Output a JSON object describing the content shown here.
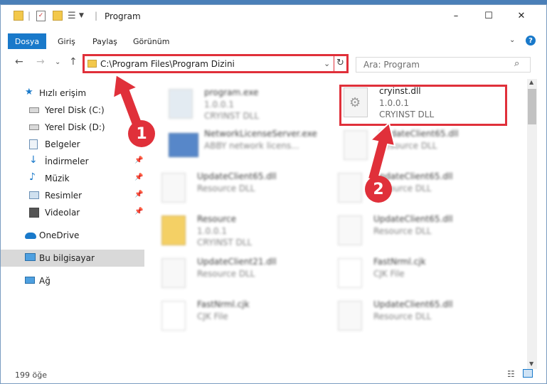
{
  "titlebar": {
    "title": "Program",
    "minimize": "–",
    "maximize": "☐",
    "close": "✕"
  },
  "ribbon": {
    "file_tab": "Dosya",
    "tabs": [
      "Giriş",
      "Paylaş",
      "Görünüm"
    ],
    "help": "?"
  },
  "nav": {
    "address": "C:\\Program Files\\Program Dizini",
    "search_placeholder": "Ara: Program"
  },
  "sidebar": {
    "items": [
      {
        "label": "Hızlı erişim",
        "icon": "star-icon"
      },
      {
        "label": "Yerel Disk (C:)",
        "icon": "drive-icon"
      },
      {
        "label": "Yerel Disk (D:)",
        "icon": "drive-icon"
      },
      {
        "label": "Belgeler",
        "icon": "documents-icon"
      },
      {
        "label": "İndirmeler",
        "icon": "download-icon"
      },
      {
        "label": "Müzik",
        "icon": "music-icon"
      },
      {
        "label": "Resimler",
        "icon": "pictures-icon"
      },
      {
        "label": "Videolar",
        "icon": "video-icon"
      },
      {
        "label": "OneDrive",
        "icon": "cloud-icon"
      },
      {
        "label": "Bu bilgisayar",
        "icon": "computer-icon"
      },
      {
        "label": "Ağ",
        "icon": "network-icon"
      }
    ]
  },
  "files": [
    {
      "name": "program.exe",
      "l2": "1.0.0.1",
      "l3": "CRYINST DLL"
    },
    {
      "name": "cryinst.dll",
      "l2": "1.0.0.1",
      "l3": "CRYINST DLL"
    },
    {
      "name": "NetworkLicenseServer.exe",
      "l2": "ABBY network licens...",
      "l3": ""
    },
    {
      "name": "UpdateClient65.dll",
      "l2": "Resource DLL",
      "l3": ""
    },
    {
      "name": "UpdateClient65.dll",
      "l2": "Resource DLL",
      "l3": ""
    },
    {
      "name": "UpdateClient65.dll",
      "l2": "Resource DLL",
      "l3": ""
    },
    {
      "name": "Resource",
      "l2": "1.0.0.1",
      "l3": "CRYINST DLL"
    },
    {
      "name": "UpdateClient65.dll",
      "l2": "Resource DLL",
      "l3": ""
    },
    {
      "name": "UpdateClient21.dll",
      "l2": "Resource DLL",
      "l3": ""
    },
    {
      "name": "FastNrml.cjk",
      "l2": "CJK File",
      "l3": ""
    },
    {
      "name": "FastNrml.cjk",
      "l2": "CJK File",
      "l3": ""
    },
    {
      "name": "UpdateClient65.dll",
      "l2": "Resource DLL",
      "l3": ""
    }
  ],
  "status": {
    "count": "199 öğe"
  },
  "annotations": {
    "step1": "1",
    "step2": "2"
  },
  "colors": {
    "accent": "#1979ca",
    "highlight": "#e0303a"
  }
}
